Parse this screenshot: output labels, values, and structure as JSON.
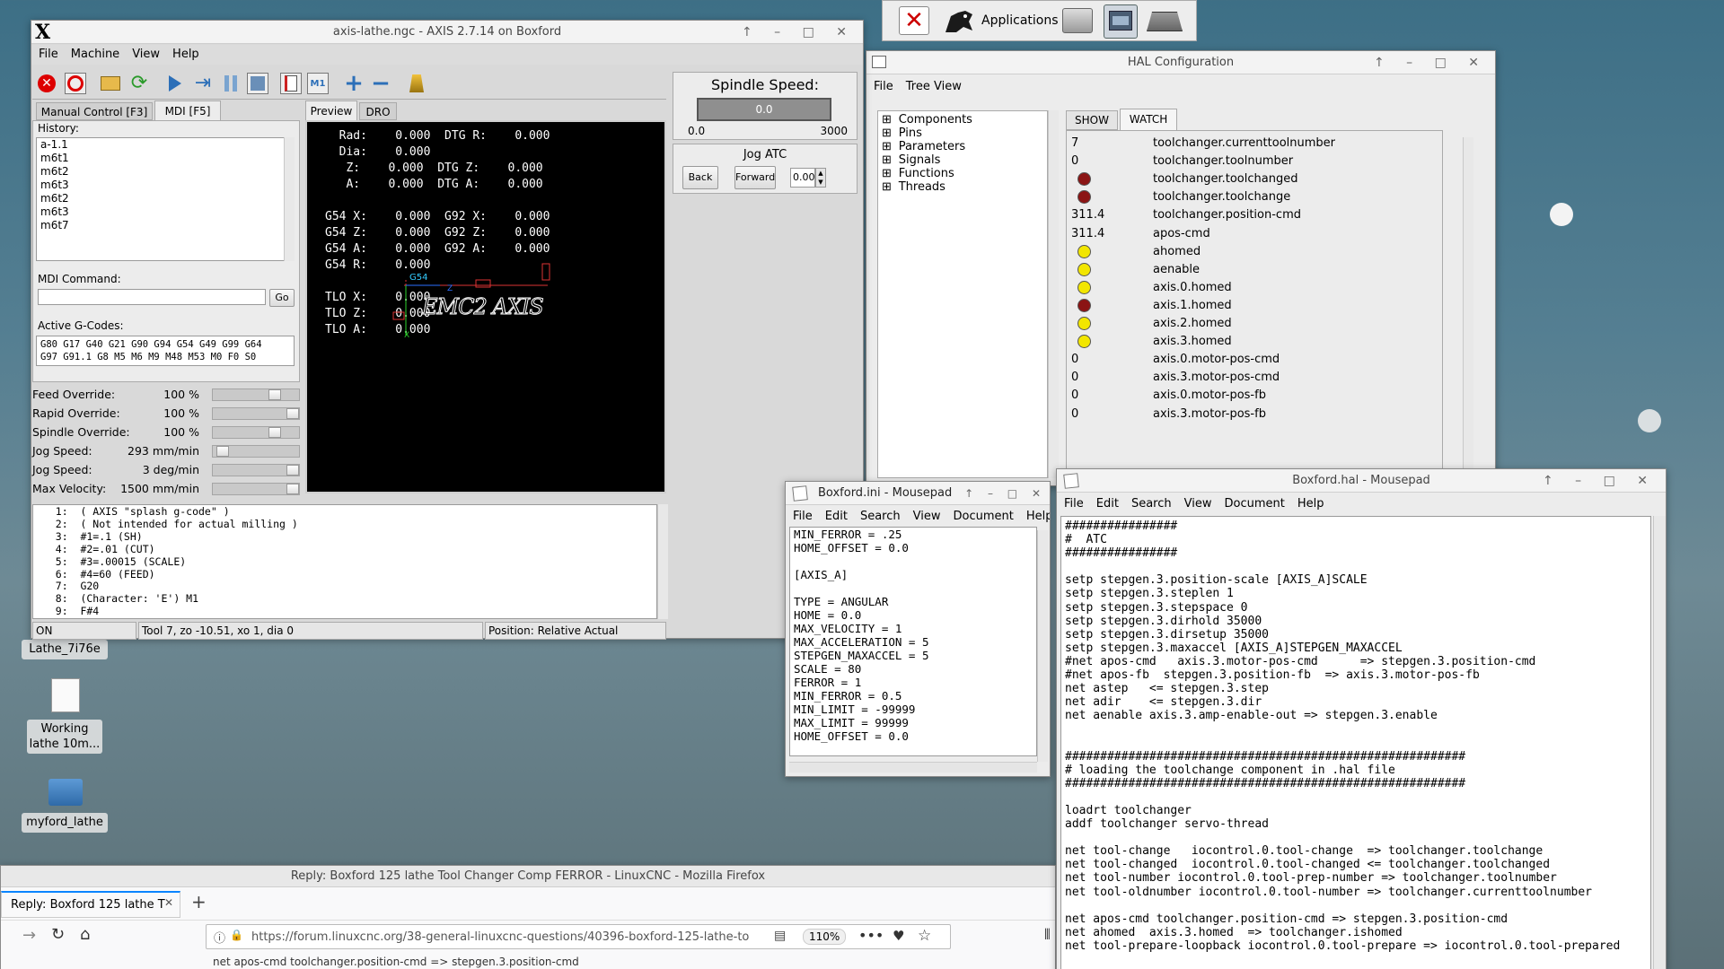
{
  "taskbar": {
    "applications": "Applications"
  },
  "desktop": {
    "icon1": "Lathe_7i76e",
    "icon2": "Working lathe 10m...",
    "icon3": "myford_lathe"
  },
  "axis": {
    "title": "axis-lathe.ngc - AXIS 2.7.14 on Boxford",
    "menu": [
      "File",
      "Machine",
      "View",
      "Help"
    ],
    "tabs_left": [
      "Manual Control [F3]",
      "MDI [F5]"
    ],
    "tabs_right": [
      "Preview",
      "DRO"
    ],
    "history_label": "History:",
    "history": "a-1.1\nm6t1\nm6t2\nm6t3\nm6t2\nm6t3\nm6t7",
    "mdi_label": "MDI Command:",
    "go": "Go",
    "gcodes_label": "Active G-Codes:",
    "gcodes": "G80 G17 G40 G21 G90 G94 G54 G49 G99 G64\nG97 G91.1 G8 M5 M6 M9 M48 M53 M0 F0 S0",
    "overrides": [
      {
        "label": "Feed Override:",
        "value": "100 %",
        "level": 0.75
      },
      {
        "label": "Rapid Override:",
        "value": "100 %",
        "level": 1.0
      },
      {
        "label": "Spindle Override:",
        "value": "100 %",
        "level": 0.75
      },
      {
        "label": "Jog Speed:",
        "value": "293 mm/min",
        "level": 0.05
      },
      {
        "label": "Jog Speed:",
        "value": "3 deg/min",
        "level": 1.0
      },
      {
        "label": "Max Velocity:",
        "value": "1500 mm/min",
        "level": 1.0
      }
    ],
    "dro": "  Rad:    0.000  DTG R:    0.000\n  Dia:    0.000\n   Z:    0.000  DTG Z:    0.000\n   A:    0.000  DTG A:    0.000\n\nG54 X:    0.000  G92 X:    0.000\nG54 Z:    0.000  G92 Z:    0.000\nG54 A:    0.000  G92 A:    0.000\nG54 R:    0.000\n\nTLO X:    0.000\nTLO Z:    0.000\nTLO A:    0.000",
    "emc_logo": "EMC2 AXIS",
    "spindle_label": "Spindle Speed:",
    "spindle_value": "0.0",
    "spindle_min": "0.0",
    "spindle_max": "3000",
    "jog_atc": "Jog ATC",
    "back": "Back",
    "forward": "Forward",
    "spin_value": "0.00",
    "gcode": "   1:  ( AXIS \"splash g-code\" )\n   2:  ( Not intended for actual milling )\n   3:  #1=.1 (SH)\n   4:  #2=.01 (CUT)\n   5:  #3=.00015 (SCALE)\n   6:  #4=60 (FEED)\n   7:  G20\n   8:  (Character: 'E') M1\n   9:  F#4",
    "status": [
      "ON",
      "Tool 7, zo -10.51, xo 1, dia 0",
      "Position: Relative Actual"
    ]
  },
  "hal": {
    "title": "HAL Configuration",
    "menu": [
      "File",
      "Tree View"
    ],
    "tree": [
      "Components",
      "Pins",
      "Parameters",
      "Signals",
      "Functions",
      "Threads"
    ],
    "tabs": [
      "SHOW",
      "WATCH"
    ],
    "watch": [
      {
        "v": "7",
        "n": "toolchanger.currenttoolnumber"
      },
      {
        "v": "0",
        "n": "toolchanger.toolnumber"
      },
      {
        "dot": "#8b1414",
        "n": "toolchanger.toolchanged"
      },
      {
        "dot": "#8b1414",
        "n": "toolchanger.toolchange"
      },
      {
        "v": "311.4",
        "n": "toolchanger.position-cmd"
      },
      {
        "v": "311.4",
        "n": "apos-cmd"
      },
      {
        "dot": "#f2e600",
        "n": "ahomed"
      },
      {
        "dot": "#f2e600",
        "n": "aenable"
      },
      {
        "dot": "#f2e600",
        "n": "axis.0.homed"
      },
      {
        "dot": "#8b1414",
        "n": "axis.1.homed"
      },
      {
        "dot": "#f2e600",
        "n": "axis.2.homed"
      },
      {
        "dot": "#f2e600",
        "n": "axis.3.homed"
      },
      {
        "v": "0",
        "n": "axis.0.motor-pos-cmd"
      },
      {
        "v": "0",
        "n": "axis.3.motor-pos-cmd"
      },
      {
        "v": "0",
        "n": "axis.0.motor-pos-fb"
      },
      {
        "v": "0",
        "n": "axis.3.motor-pos-fb"
      }
    ]
  },
  "ini": {
    "title": "Boxford.ini - Mousepad",
    "menu": [
      "File",
      "Edit",
      "Search",
      "View",
      "Document",
      "Help"
    ],
    "text": "MIN_FERROR = .25\nHOME_OFFSET = 0.0\n\n[AXIS_A]\n\nTYPE = ANGULAR\nHOME = 0.0\nMAX_VELOCITY = 1\nMAX_ACCELERATION = 5\nSTEPGEN_MAXACCEL = 5\nSCALE = 80\nFERROR = 1\nMIN_FERROR = 0.5\nMIN_LIMIT = -99999\nMAX_LIMIT = 99999\nHOME_OFFSET = 0.0"
  },
  "halfile": {
    "title": "Boxford.hal - Mousepad",
    "menu": [
      "File",
      "Edit",
      "Search",
      "View",
      "Document",
      "Help"
    ],
    "text": "################\n#  ATC\n################\n\nsetp stepgen.3.position-scale [AXIS_A]SCALE\nsetp stepgen.3.steplen 1\nsetp stepgen.3.stepspace 0\nsetp stepgen.3.dirhold 35000\nsetp stepgen.3.dirsetup 35000\nsetp stepgen.3.maxaccel [AXIS_A]STEPGEN_MAXACCEL\n#net apos-cmd   axis.3.motor-pos-cmd      => stepgen.3.position-cmd\n#net apos-fb  stepgen.3.position-fb  => axis.3.motor-pos-fb\nnet astep   <= stepgen.3.step\nnet adir    <= stepgen.3.dir\nnet aenable axis.3.amp-enable-out => stepgen.3.enable\n\n\n#########################################################\n# loading the toolchange component in .hal file\n#########################################################\n\nloadrt toolchanger\naddf toolchanger servo-thread\n\nnet tool-change   iocontrol.0.tool-change  => toolchanger.toolchange\nnet tool-changed  iocontrol.0.tool-changed <= toolchanger.toolchanged\nnet tool-number iocontrol.0.tool-prep-number => toolchanger.toolnumber\nnet tool-oldnumber iocontrol.0.tool-number => toolchanger.currenttoolnumber\n\nnet apos-cmd toolchanger.position-cmd => stepgen.3.position-cmd\nnet ahomed  axis.3.homed  => toolchanger.ishomed\nnet tool-prepare-loopback iocontrol.0.tool-prepare => iocontrol.0.tool-prepared"
  },
  "firefox": {
    "title": "Reply: Boxford 125 lathe Tool Changer Comp FERROR - LinuxCNC - Mozilla Firefox",
    "tab": "Reply: Boxford 125 lathe T",
    "url": "https://forum.linuxcnc.org/38-general-linuxcnc-questions/40396-boxford-125-lathe-to",
    "zoom": "110%",
    "content": "net apos-cmd toolchanger.position-cmd => stepgen.3.position-cmd"
  }
}
